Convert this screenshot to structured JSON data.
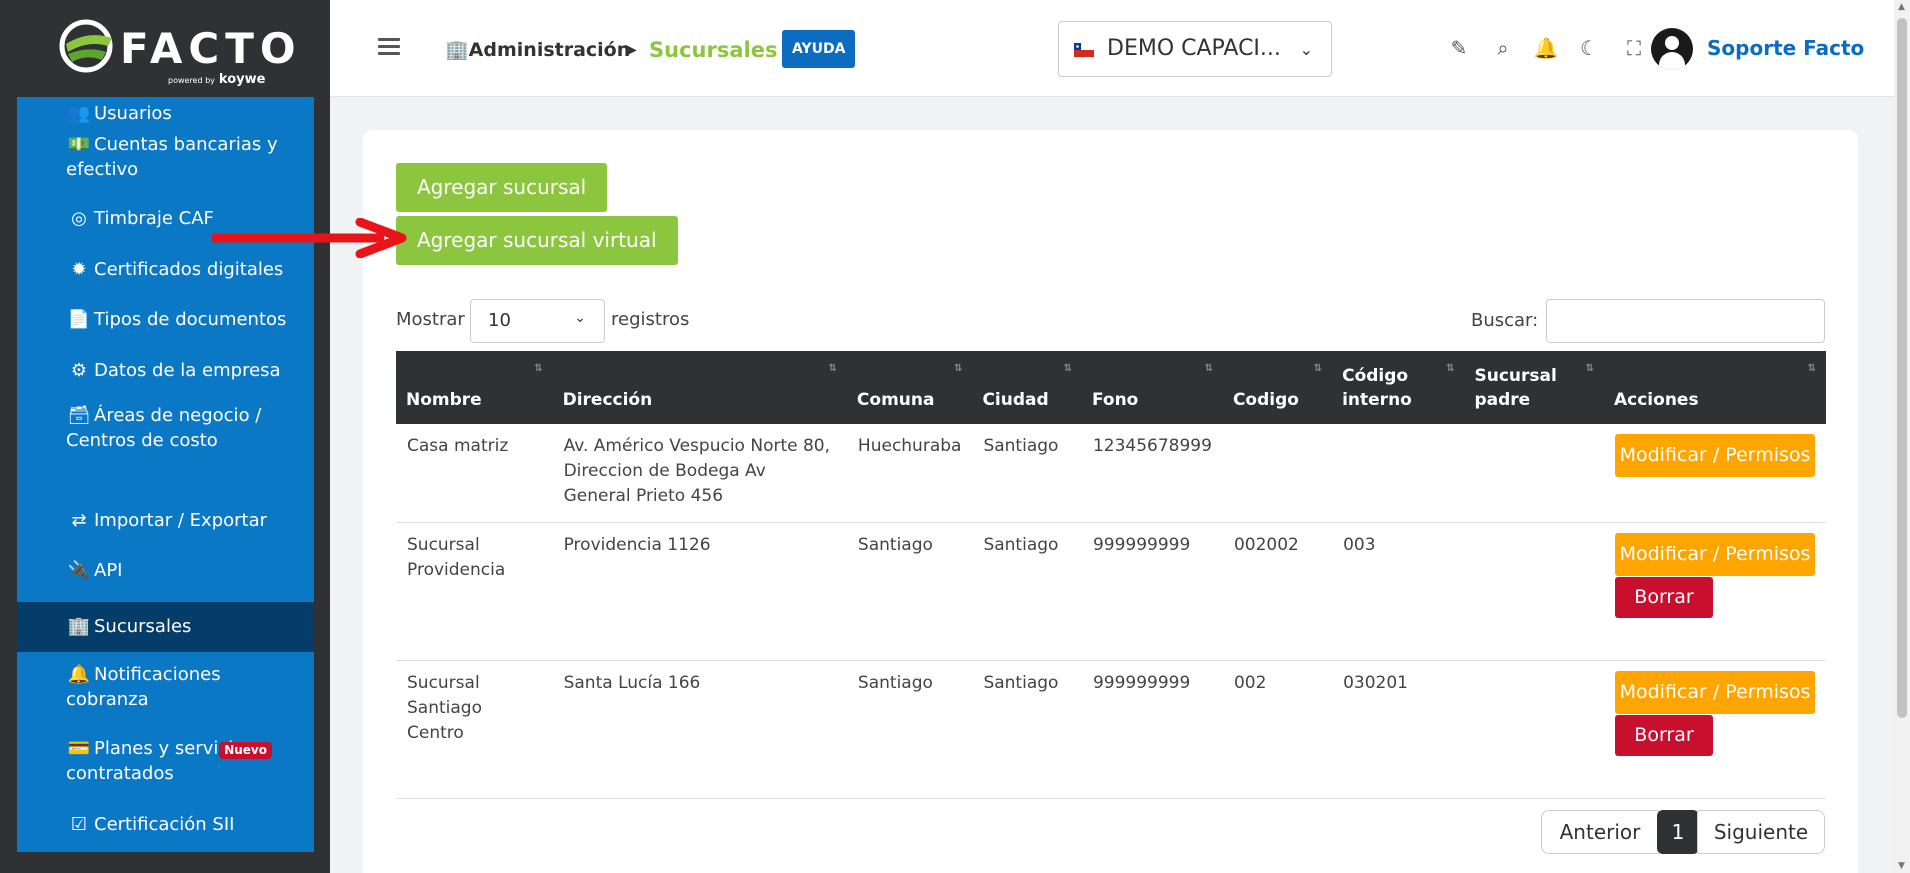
{
  "brand": {
    "name": "FACTO",
    "powered_by": "powered by",
    "partner": "koywe"
  },
  "sidebar": {
    "items": [
      {
        "icon": "users-icon",
        "glyph": "👥",
        "label": "Usuarios"
      },
      {
        "icon": "money-icon",
        "glyph": "💵",
        "label": "Cuentas bancarias y efectivo"
      },
      {
        "icon": "target-icon",
        "glyph": "◎",
        "label": "Timbraje CAF"
      },
      {
        "icon": "certificate-icon",
        "glyph": "✹",
        "label": "Certificados digitales"
      },
      {
        "icon": "file-icon",
        "glyph": "📄",
        "label": "Tipos de documentos"
      },
      {
        "icon": "gear-icon",
        "glyph": "⚙",
        "label": "Datos de la empresa"
      },
      {
        "icon": "archive-icon",
        "glyph": "🗃",
        "label": "Áreas de negocio / Centros de costo"
      },
      {
        "icon": "exchange-icon",
        "glyph": "⇄",
        "label": "Importar / Exportar"
      },
      {
        "icon": "plug-icon",
        "glyph": "🔌",
        "label": "API"
      },
      {
        "icon": "building-icon",
        "glyph": "🏢",
        "label": "Sucursales"
      },
      {
        "icon": "bell-icon",
        "glyph": "🔔",
        "label": "Notificaciones cobranza"
      },
      {
        "icon": "card-icon",
        "glyph": "💳",
        "label": "Planes y servicios contratados"
      },
      {
        "icon": "check-square-icon",
        "glyph": "☑",
        "label": "Certificación SII"
      }
    ],
    "badge": "Nuevo",
    "active": "Sucursales"
  },
  "header": {
    "breadcrumb_parent": "Administración",
    "breadcrumb_current": "Sucursales",
    "help_label": "AYUDA",
    "company": "DEMO CAPACI...",
    "user_name": "Soporte Facto"
  },
  "actions": {
    "add_branch": "Agregar sucursal",
    "add_virtual_branch": "Agregar sucursal virtual"
  },
  "table_controls": {
    "show_label": "Mostrar",
    "page_size": "10",
    "records_label": "registros",
    "search_label": "Buscar:",
    "search_value": ""
  },
  "table": {
    "headers": [
      "Nombre",
      "Dirección",
      "Comuna",
      "Ciudad",
      "Fono",
      "Codigo",
      "Código interno",
      "Sucursal padre",
      "Acciones"
    ],
    "rows": [
      {
        "nombre": "Casa matriz",
        "direccion": "Av. Américo Vespucio Norte 80, Direccion de Bodega Av General Prieto 456",
        "comuna": "Huechuraba",
        "ciudad": "Santiago",
        "fono": "12345678999",
        "codigo": "",
        "codigo_interno": "",
        "sucursal_padre": ""
      },
      {
        "nombre": "Sucursal Providencia",
        "direccion": "Providencia 1126",
        "comuna": "Santiago",
        "ciudad": "Santiago",
        "fono": "999999999",
        "codigo": "002002",
        "codigo_interno": "003",
        "sucursal_padre": ""
      },
      {
        "nombre": "Sucursal Santiago Centro",
        "direccion": "Santa Lucía 166",
        "comuna": "Santiago",
        "ciudad": "Santiago",
        "fono": "999999999",
        "codigo": "002",
        "codigo_interno": "030201",
        "sucursal_padre": ""
      }
    ],
    "modify_label": "Modificar / Permisos",
    "delete_label": "Borrar"
  },
  "pagination": {
    "prev": "Anterior",
    "current": "1",
    "next": "Siguiente"
  },
  "colors": {
    "sidebar_menu": "#0b78c5",
    "sidebar_active": "#053d6a",
    "green": "#8cc63f",
    "orange": "#ffa500",
    "red": "#c8102e",
    "dark": "#2f3235"
  }
}
